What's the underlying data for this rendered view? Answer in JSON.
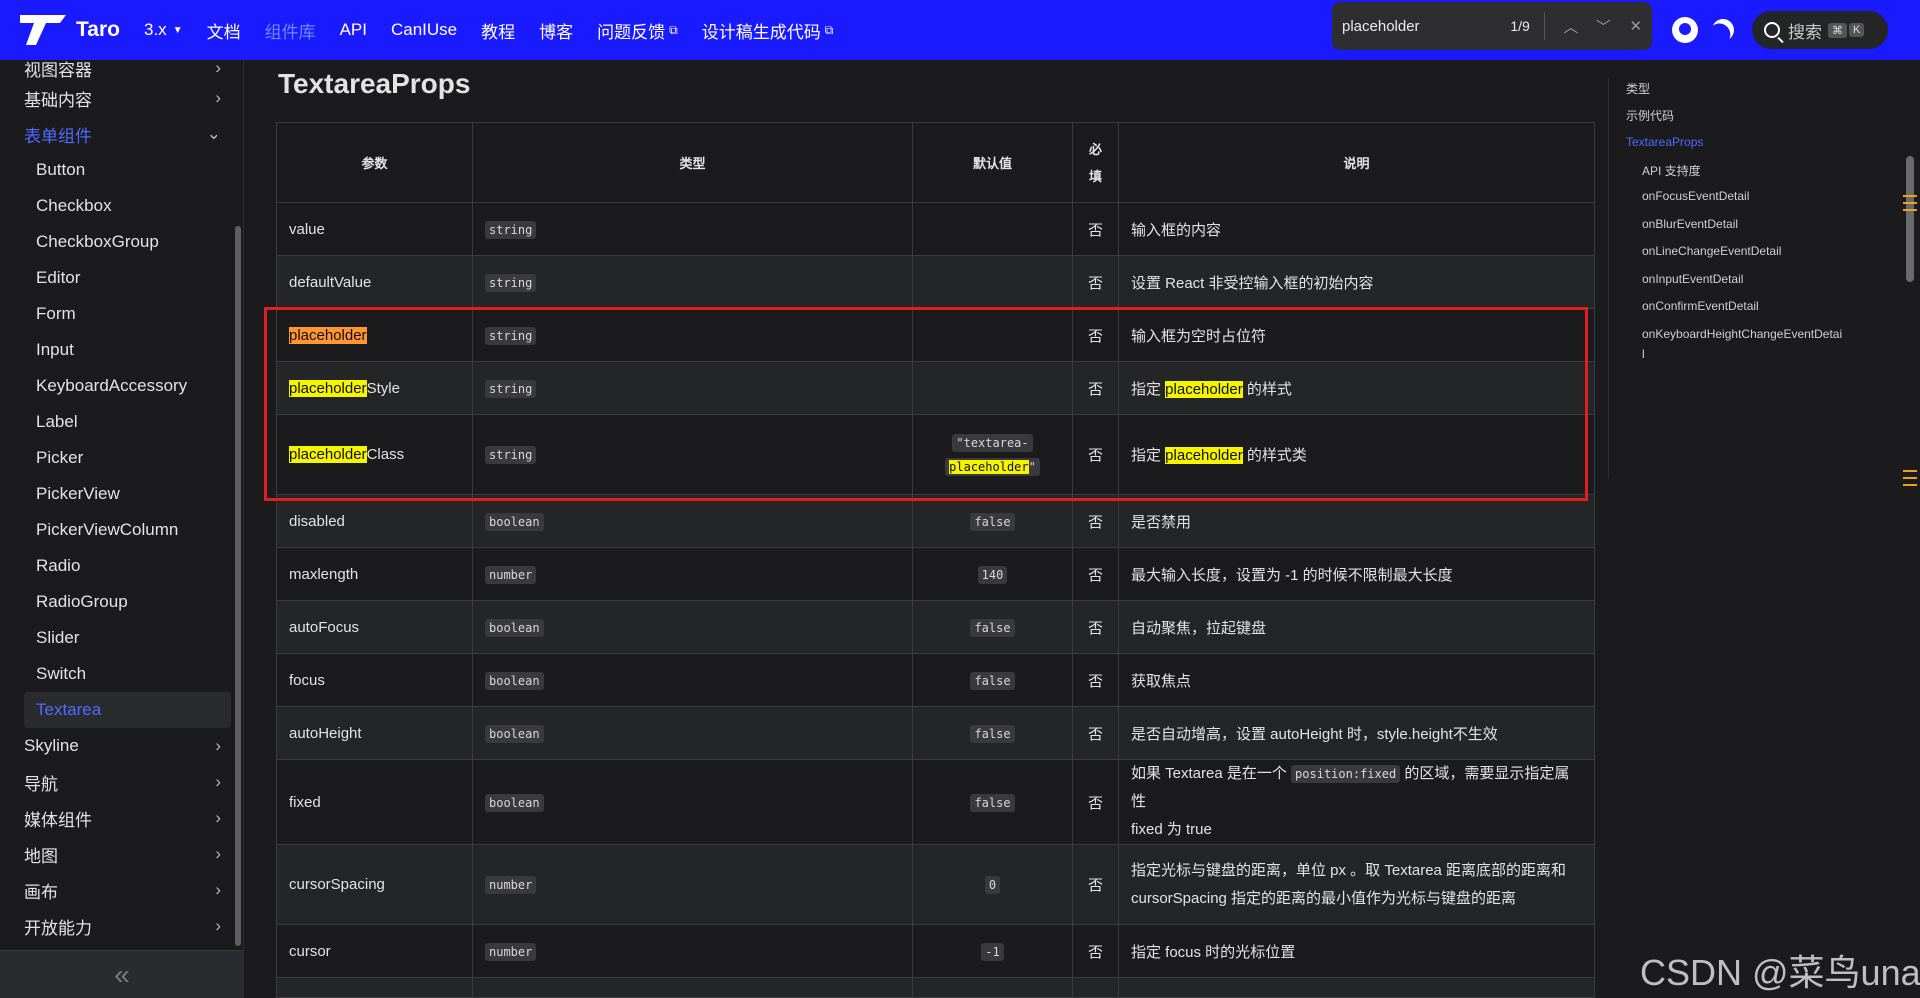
{
  "navbar": {
    "logo_text": "Taro",
    "items": [
      {
        "label": "3.x",
        "type": "dropdown"
      },
      {
        "label": "文档"
      },
      {
        "label": "组件库",
        "active": true
      },
      {
        "label": "API"
      },
      {
        "label": "CanIUse"
      },
      {
        "label": "教程"
      },
      {
        "label": "博客"
      },
      {
        "label": "问题反馈",
        "external": true
      },
      {
        "label": "设计稿生成代码",
        "external": true
      }
    ],
    "search_label": "搜索",
    "search_kbd": [
      "⌘",
      "K"
    ]
  },
  "find_bar": {
    "query": "placeholder",
    "count": "1/9"
  },
  "sidebar": {
    "items_top": [
      {
        "label": "视图容器"
      },
      {
        "label": "基础内容"
      },
      {
        "label": "表单组件"
      }
    ],
    "sub_items": [
      "Button",
      "Checkbox",
      "CheckboxGroup",
      "Editor",
      "Form",
      "Input",
      "KeyboardAccessory",
      "Label",
      "Picker",
      "PickerView",
      "PickerViewColumn",
      "Radio",
      "RadioGroup",
      "Slider",
      "Switch",
      "Textarea"
    ],
    "items_bottom": [
      {
        "label": "Skyline"
      },
      {
        "label": "导航"
      },
      {
        "label": "媒体组件"
      },
      {
        "label": "地图"
      },
      {
        "label": "画布"
      },
      {
        "label": "开放能力"
      }
    ],
    "collapse_glyph": "«"
  },
  "main": {
    "title": "TextareaProps",
    "headers": {
      "param": "参数",
      "type": "类型",
      "default": "默认值",
      "required": "必\n填",
      "desc": "说明"
    },
    "rows": [
      {
        "param": "value",
        "type": "string",
        "default": "",
        "required": "否",
        "desc": "输入框的内容"
      },
      {
        "param": "defaultValue",
        "type": "string",
        "default": "",
        "required": "否",
        "desc": "设置 React 非受控输入框的初始内容"
      },
      {
        "param": "placeholder",
        "type": "string",
        "default": "",
        "required": "否",
        "desc": "输入框为空时占位符"
      },
      {
        "param": "placeholderStyle",
        "type": "string",
        "default": "",
        "required": "否",
        "desc": "指定 placeholder 的样式"
      },
      {
        "param": "placeholderClass",
        "type": "string",
        "default": "\"textarea-placeholder\"",
        "required": "否",
        "desc": "指定 placeholder 的样式类"
      },
      {
        "param": "disabled",
        "type": "boolean",
        "default": "false",
        "required": "否",
        "desc": "是否禁用"
      },
      {
        "param": "maxlength",
        "type": "number",
        "default": "140",
        "required": "否",
        "desc": "最大输入长度，设置为 -1 的时候不限制最大长度"
      },
      {
        "param": "autoFocus",
        "type": "boolean",
        "default": "false",
        "required": "否",
        "desc": "自动聚焦，拉起键盘"
      },
      {
        "param": "focus",
        "type": "boolean",
        "default": "false",
        "required": "否",
        "desc": "获取焦点"
      },
      {
        "param": "autoHeight",
        "type": "boolean",
        "default": "false",
        "required": "否",
        "desc": "是否自动增高，设置 autoHeight 时，style.height不生效"
      },
      {
        "param": "fixed",
        "type": "boolean",
        "default": "false",
        "required": "否",
        "desc": "如果 Textarea 是在一个 position:fixed 的区域，需要显示指定属性 fixed 为 true"
      },
      {
        "param": "cursorSpacing",
        "type": "number",
        "default": "0",
        "required": "否",
        "desc": "指定光标与键盘的距离，单位 px 。取 Textarea 距离底部的距离和 cursorSpacing 指定的距离的最小值作为光标与键盘的距离"
      },
      {
        "param": "cursor",
        "type": "number",
        "default": "-1",
        "required": "否",
        "desc": "指定 focus 时的光标位置"
      }
    ],
    "desc_parts": {
      "style_prefix": "指定 ",
      "style_suffix": " 的样式",
      "class_suffix": " 的样式类",
      "fixed_a": "如果 Textarea 是在一个 ",
      "fixed_code": "position:fixed",
      "fixed_b": " 的区域，需要显示指定属性",
      "fixed_c": "fixed 为 true",
      "cs_a": "指定光标与键盘的距离，单位 px 。取 Textarea 距离底部的距离和",
      "cs_b": "cursorSpacing 指定的距离的最小值作为光标与键盘的距离",
      "ph_default_a": "\"textarea-",
      "ph_default_b": "placeholder",
      "ph_default_c": "\"",
      "hl_word": "placeholder",
      "style_tail": "Style",
      "class_tail": "Class"
    }
  },
  "toc": {
    "items": [
      {
        "label": "类型",
        "level": 1
      },
      {
        "label": "示例代码",
        "level": 1
      },
      {
        "label": "TextareaProps",
        "level": 1,
        "active": true
      },
      {
        "label": "API 支持度",
        "level": 2
      },
      {
        "label": "onFocusEventDetail",
        "level": 2
      },
      {
        "label": "onBlurEventDetail",
        "level": 2
      },
      {
        "label": "onLineChangeEventDetail",
        "level": 2
      },
      {
        "label": "onInputEventDetail",
        "level": 2
      },
      {
        "label": "onConfirmEventDetail",
        "level": 2
      },
      {
        "label": "onKeyboardHeightChangeEventDetai",
        "level": 2
      },
      {
        "label": "l",
        "level": 2
      }
    ]
  },
  "watermark": "CSDN @菜鸟una",
  "colors": {
    "navbar": "#1a1aff",
    "accent": "#4e6bff",
    "highlight": "#f5f500",
    "current_match": "#ff9632",
    "annotation": "#e1201d"
  }
}
